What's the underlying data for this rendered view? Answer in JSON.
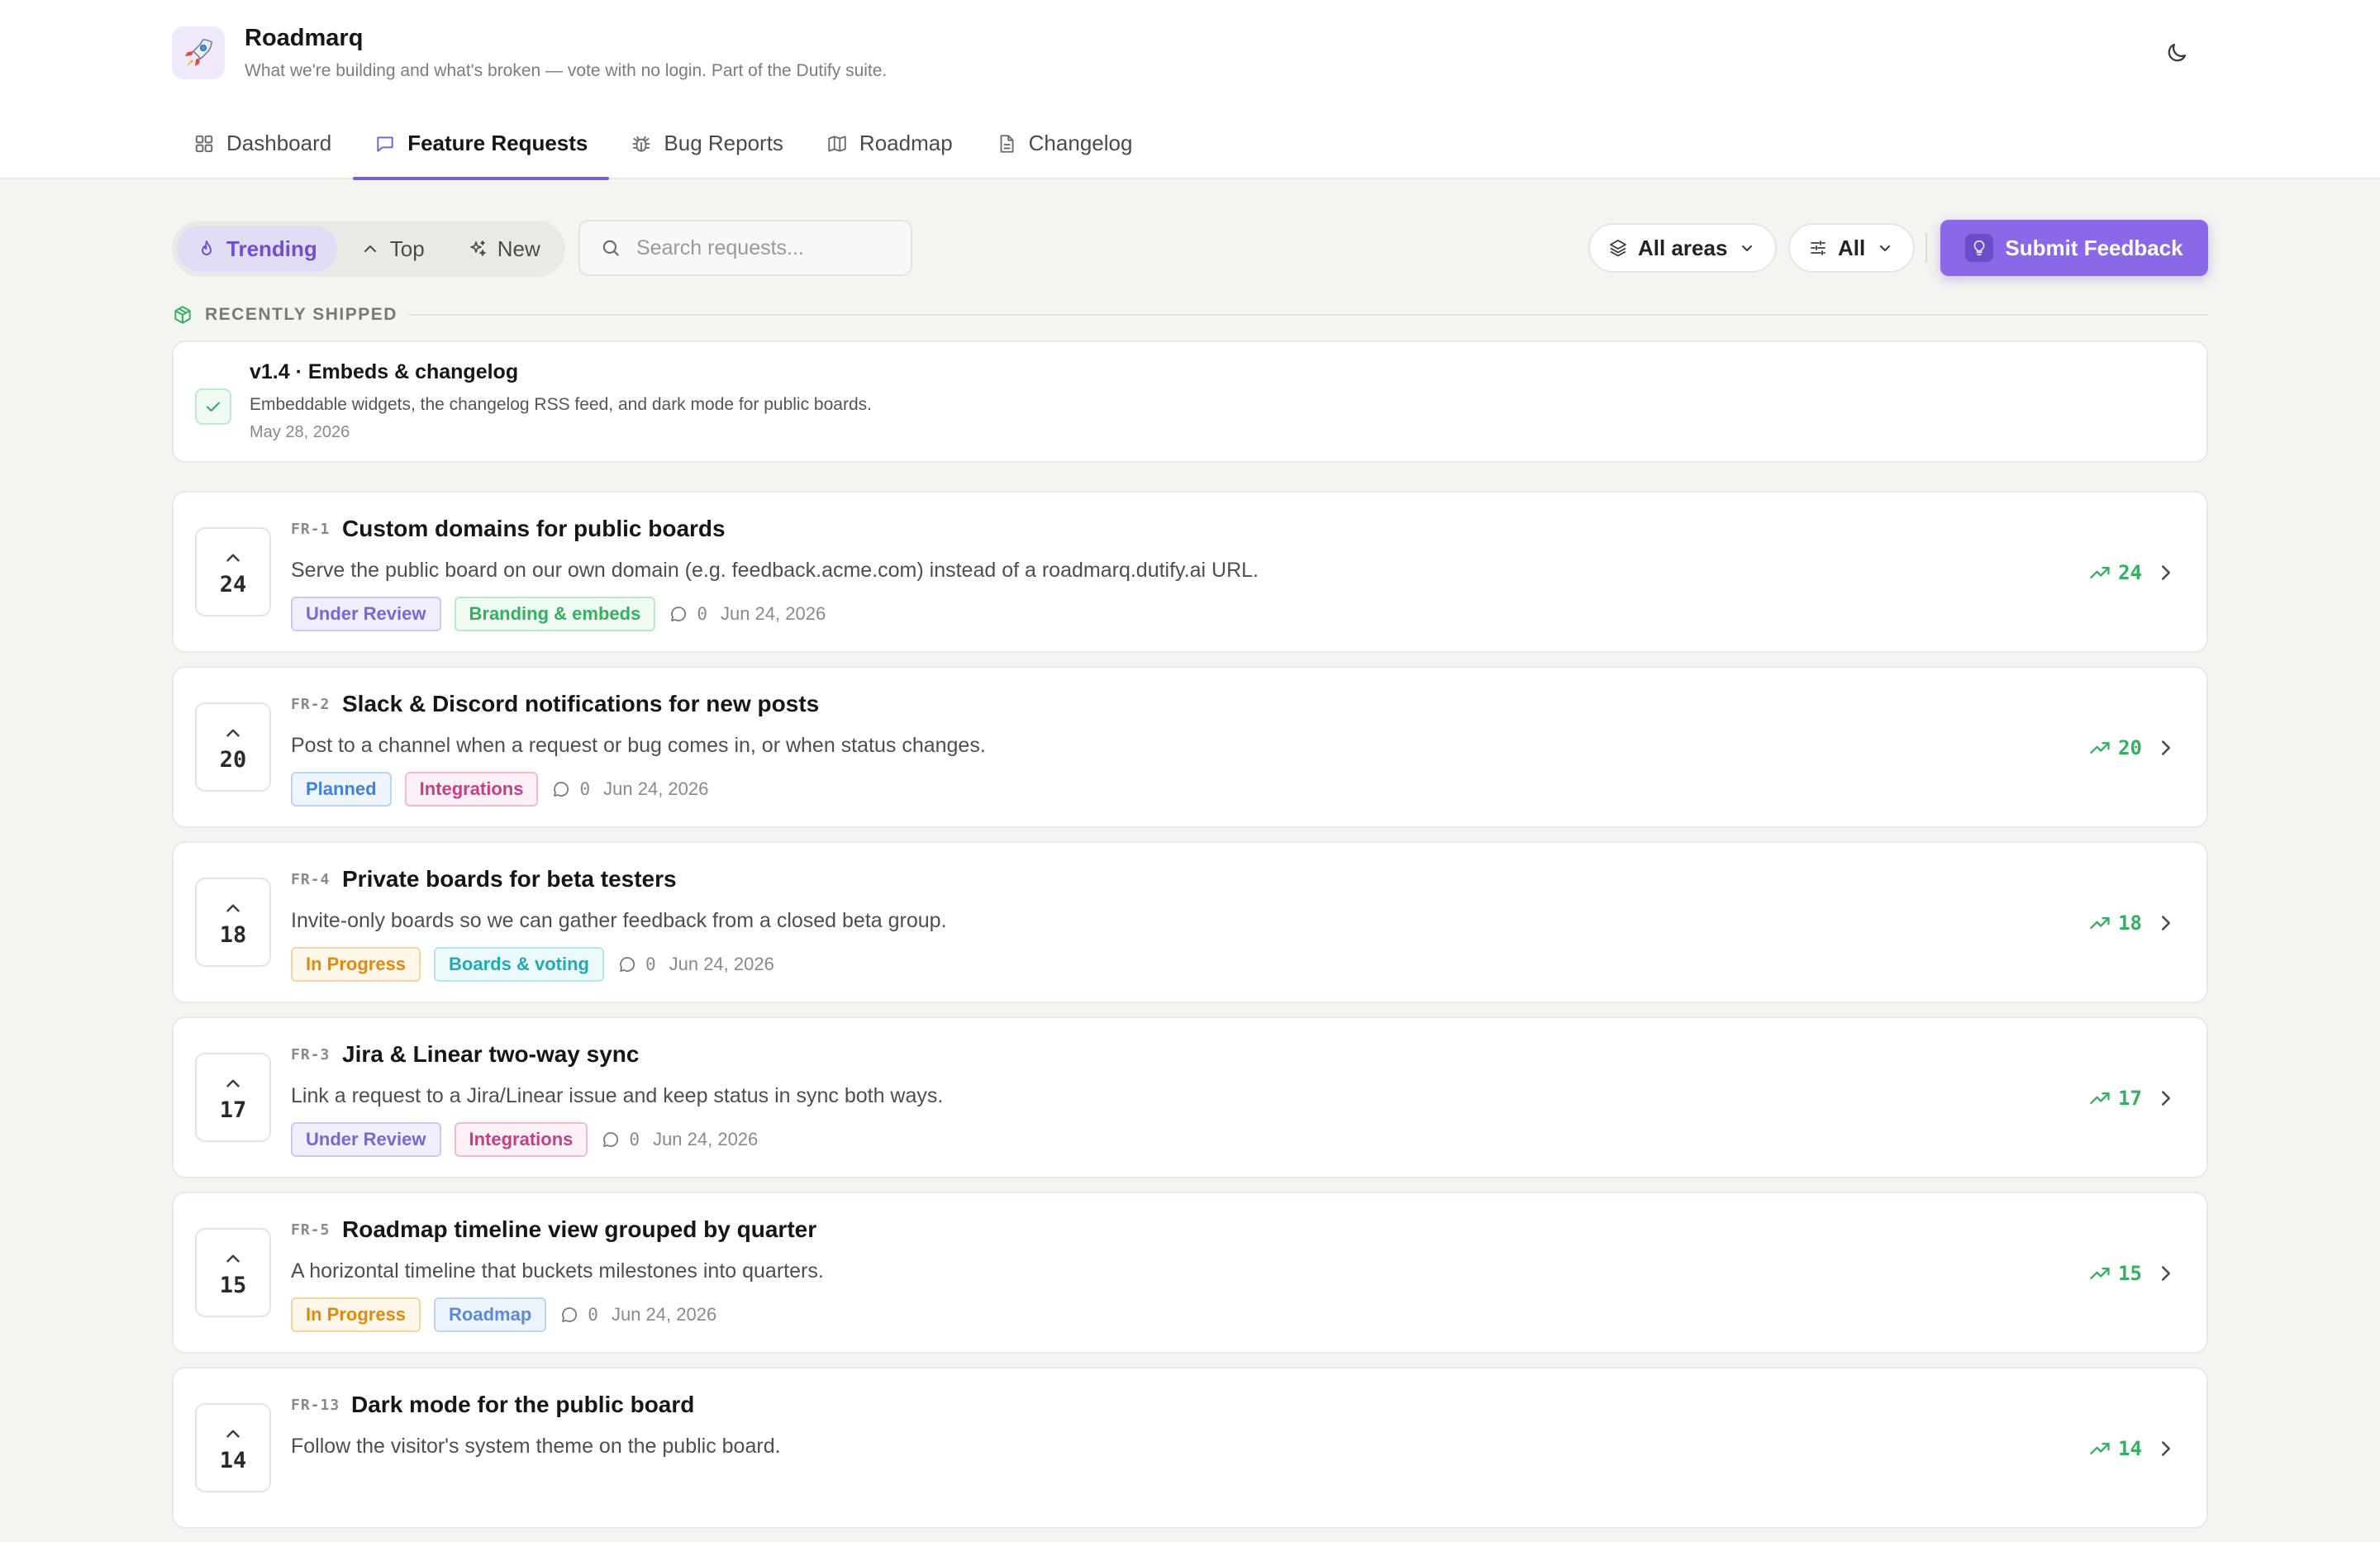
{
  "app": {
    "title": "Roadmarq",
    "subtitle": "What we're building and what's broken — vote with no login. Part of the Dutify suite."
  },
  "nav": {
    "tabs": [
      {
        "label": "Dashboard",
        "icon": "grid-icon"
      },
      {
        "label": "Feature Requests",
        "icon": "message-square-icon",
        "active": true
      },
      {
        "label": "Bug Reports",
        "icon": "bug-icon"
      },
      {
        "label": "Roadmap",
        "icon": "map-icon"
      },
      {
        "label": "Changelog",
        "icon": "file-text-icon"
      }
    ]
  },
  "toolbar": {
    "sort": [
      {
        "label": "Trending",
        "icon": "flame-icon",
        "active": true
      },
      {
        "label": "Top",
        "icon": "chevron-up-icon"
      },
      {
        "label": "New",
        "icon": "sparkles-icon"
      }
    ],
    "search_placeholder": "Search requests...",
    "area_filter": "All areas",
    "status_filter": "All",
    "submit_label": "Submit Feedback"
  },
  "recently_shipped": {
    "heading": "RECENTLY SHIPPED",
    "items": [
      {
        "title": "v1.4 · Embeds & changelog",
        "description": "Embeddable widgets, the changelog RSS feed, and dark mode for public boards.",
        "date": "May 28, 2026"
      }
    ]
  },
  "requests": [
    {
      "id": "FR-1",
      "title": "Custom domains for public boards",
      "description": "Serve the public board on our own domain (e.g. feedback.acme.com) instead of a roadmarq.dutify.ai URL.",
      "votes": "24",
      "status": "Under Review",
      "area": "Branding & embeds",
      "comments": "0",
      "date": "Jun 24, 2026",
      "trend": "24"
    },
    {
      "id": "FR-2",
      "title": "Slack & Discord notifications for new posts",
      "description": "Post to a channel when a request or bug comes in, or when status changes.",
      "votes": "20",
      "status": "Planned",
      "area": "Integrations",
      "comments": "0",
      "date": "Jun 24, 2026",
      "trend": "20"
    },
    {
      "id": "FR-4",
      "title": "Private boards for beta testers",
      "description": "Invite-only boards so we can gather feedback from a closed beta group.",
      "votes": "18",
      "status": "In Progress",
      "area": "Boards & voting",
      "comments": "0",
      "date": "Jun 24, 2026",
      "trend": "18"
    },
    {
      "id": "FR-3",
      "title": "Jira & Linear two-way sync",
      "description": "Link a request to a Jira/Linear issue and keep status in sync both ways.",
      "votes": "17",
      "status": "Under Review",
      "area": "Integrations",
      "comments": "0",
      "date": "Jun 24, 2026",
      "trend": "17"
    },
    {
      "id": "FR-5",
      "title": "Roadmap timeline view grouped by quarter",
      "description": "A horizontal timeline that buckets milestones into quarters.",
      "votes": "15",
      "status": "In Progress",
      "area": "Roadmap",
      "comments": "0",
      "date": "Jun 24, 2026",
      "trend": "15"
    },
    {
      "id": "FR-13",
      "title": "Dark mode for the public board",
      "description": "Follow the visitor's system theme on the public board.",
      "votes": "14",
      "status": "",
      "area": "",
      "comments": "",
      "date": "",
      "trend": "14"
    }
  ],
  "tag_colors": {
    "Under Review": {
      "bg": "#f1effd",
      "border": "#cfc6f3",
      "fg": "#7b66d6"
    },
    "Planned": {
      "bg": "#eef5fe",
      "border": "#b9d5f6",
      "fg": "#3f82d8"
    },
    "In Progress": {
      "bg": "#fff7ea",
      "border": "#f6d3a0",
      "fg": "#e08a12"
    },
    "Branding & embeds": {
      "bg": "#effbf3",
      "border": "#b8e9c8",
      "fg": "#34b060"
    },
    "Integrations": {
      "bg": "#fdf0f6",
      "border": "#f2b9d4",
      "fg": "#c43f83"
    },
    "Boards & voting": {
      "bg": "#edfafb",
      "border": "#b2e6ea",
      "fg": "#22a9b4"
    },
    "Roadmap": {
      "bg": "#eef4fd",
      "border": "#bfd3f2",
      "fg": "#5b8ad8"
    }
  },
  "colors": {
    "accent": "#8a68e8",
    "trend_green": "#36b05e",
    "page_bg": "#f4f4f1"
  }
}
